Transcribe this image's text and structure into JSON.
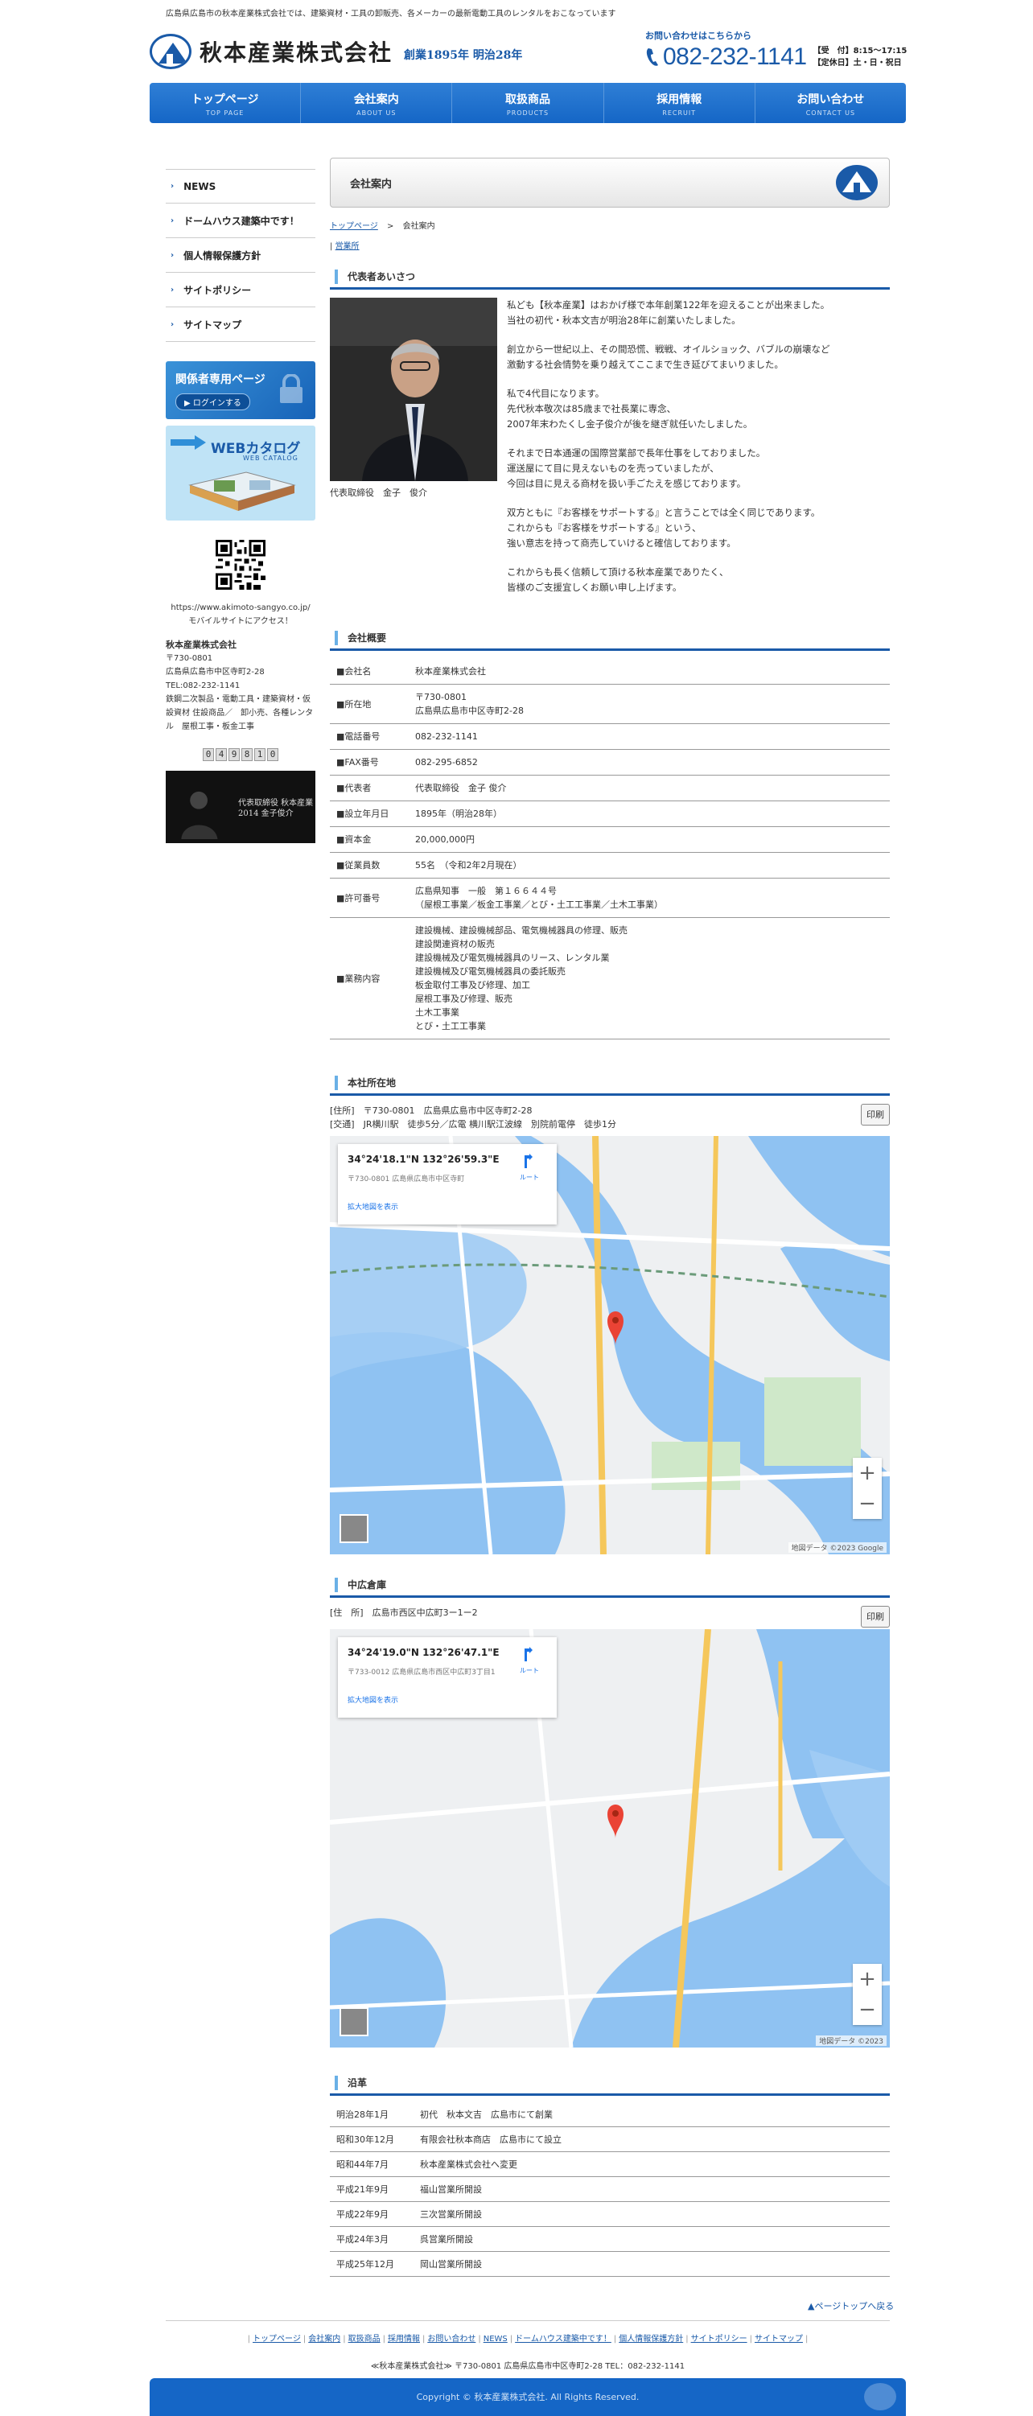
{
  "header": {
    "tagline": "広島県広島市の秋本産業株式会社では、建築資材・工具の卸販売、各メーカーの最新電動工具のレンタルをおこなっています",
    "company_name": "秋本産業株式会社",
    "founded": "創業1895年 明治28年",
    "contact_label": "お問い合わせはこちらから",
    "phone": "082-232-1141",
    "hours_line1": "【受　付】8:15～17:15",
    "hours_line2": "【定休日】土・日・祝日"
  },
  "gnav": [
    {
      "label": "トップページ",
      "sub": "TOP PAGE"
    },
    {
      "label": "会社案内",
      "sub": "ABOUT US"
    },
    {
      "label": "取扱商品",
      "sub": "PRODUCTS"
    },
    {
      "label": "採用情報",
      "sub": "RECRUIT"
    },
    {
      "label": "お問い合わせ",
      "sub": "CONTACT US"
    }
  ],
  "sidebar": {
    "menu": [
      "NEWS",
      "ドームハウス建築中です！",
      "個人情報保護方針",
      "サイトポリシー",
      "サイトマップ"
    ],
    "login_title": "関係者専用ページ",
    "login_button": "▶ ログインする",
    "catalog_title": "WEBカタログ",
    "catalog_sub": "WEB CATALOG",
    "qr_url": "https://www.akimoto-sangyo.co.jp/",
    "qr_note": "モバイルサイトにアクセス！",
    "company": "秋本産業株式会社",
    "zip": "〒730-0801",
    "address": "広島県広島市中区寺町2-28",
    "tel": "TEL:082-232-1141",
    "business": "鉄鋼二次製品・電動工具・建築資材・仮設資材 住設商品／　卸小売、各種レンタル　屋根工事・板金工事",
    "counter": [
      "0",
      "4",
      "9",
      "8",
      "1",
      "0"
    ],
    "president_banner": "代表取締役 秋本産業\n2014 金子俊介"
  },
  "page": {
    "title": "会社案内",
    "crumb_home": "トップページ",
    "crumb_sep": ">",
    "crumb_current": "会社案内",
    "sublink_sep": "|",
    "sublink": "営業所"
  },
  "greeting": {
    "heading": "代表者あいさつ",
    "caption": "代表取締役　金子　俊介",
    "paragraphs": [
      "私ども【秋本産業】はおかげ様で本年創業122年を迎えることが出来ました。\n当社の初代・秋本文吉が明治28年に創業いたしました。",
      "創立から一世紀以上、その間恐慌、戦戦、オイルショック、バブルの崩壊など\n激動する社会情勢を乗り越えてここまで生き延びてまいりました。",
      "私で4代目になります。\n先代秋本敬次は85歳まで社長業に専念、\n2007年末わたくし金子俊介が後を継ぎ就任いたしました。",
      "それまで日本通運の国際営業部で長年仕事をしておりました。\n運送屋にて目に見えないものを売っていましたが、\n今回は目に見える商材を扱い手ごたえを感じております。",
      "双方ともに『お客様をサポートする』と言うことでは全く同じであります。\nこれからも『お客様をサポートする』という、\n強い意志を持って商売していけると確信しております。",
      "これからも長く信頼して頂ける秋本産業でありたく、\n皆様のご支援宜しくお願い申し上げます。"
    ]
  },
  "overview": {
    "heading": "会社概要",
    "rows": [
      {
        "k": "■会社名",
        "v": "秋本産業株式会社"
      },
      {
        "k": "■所在地",
        "v": "〒730-0801\n広島県広島市中区寺町2-28"
      },
      {
        "k": "■電話番号",
        "v": "082-232-1141"
      },
      {
        "k": "■FAX番号",
        "v": "082-295-6852"
      },
      {
        "k": "■代表者",
        "v": "代表取締役　金子 俊介"
      },
      {
        "k": "■設立年月日",
        "v": "1895年（明治28年）"
      },
      {
        "k": "■資本金",
        "v": "20,000,000円"
      },
      {
        "k": "■従業員数",
        "v": "55名　（令和2年2月現在）"
      },
      {
        "k": "■許可番号",
        "v": "広島県知事　一般　第１６６４４号\n（屋根工事業／板金工事業／とび・土工工事業／土木工事業）"
      },
      {
        "k": "■業務内容",
        "v": "建設機械、建設機械部品、電気機械器具の修理、販売\n建設関連資材の販売\n建設機械及び電気機械器具のリース、レンタル業\n建設機械及び電気機械器具の委託販売\n板金取付工事及び修理、加工\n屋根工事及び修理、販売\n土木工事業\nとび・土工工事業"
      }
    ]
  },
  "hq_map": {
    "heading": "本社所在地",
    "address": "[住所]　〒730-0801　広島県広島市中区寺町2-28",
    "access": "[交通]　JR横川駅　徒歩5分／広電 横川駅江波線　別院前電停　徒歩1分",
    "print": "印刷",
    "coord": "34°24'18.1\"N 132°26'59.3\"E",
    "sub": "〒730-0801 広島県広島市中区寺町",
    "link": "拡大地図を表示",
    "route": "ルート",
    "attrib": "地図データ ©2023 Google"
  },
  "warehouse_map": {
    "heading": "中広倉庫",
    "address": "[住　所]　広島市西区中広町3ー1ー2",
    "print": "印刷",
    "coord": "34°24'19.0\"N 132°26'47.1\"E",
    "sub": "〒733-0012 広島県広島市西区中広町3丁目1",
    "link": "拡大地図を表示",
    "route": "ルート",
    "attrib": "地図データ ©2023"
  },
  "history": {
    "heading": "沿革",
    "rows": [
      {
        "k": "明治28年1月",
        "v": "初代　秋本文吉　広島市にて創業"
      },
      {
        "k": "昭和30年12月",
        "v": "有限会社秋本商店　広島市にて設立"
      },
      {
        "k": "昭和44年7月",
        "v": "秋本産業株式会社へ変更"
      },
      {
        "k": "平成21年9月",
        "v": "福山営業所開設"
      },
      {
        "k": "平成22年9月",
        "v": "三次営業所開設"
      },
      {
        "k": "平成24年3月",
        "v": "呉営業所開設"
      },
      {
        "k": "平成25年12月",
        "v": "岡山営業所開設"
      }
    ]
  },
  "footer": {
    "pagetop": "▲ページトップへ戻る",
    "links": [
      "トップページ",
      "会社案内",
      "取扱商品",
      "採用情報",
      "お問い合わせ",
      "NEWS",
      "ドームハウス建築中です！",
      "個人情報保護方針",
      "サイトポリシー",
      "サイトマップ"
    ],
    "address": "≪秋本産業株式会社≫ 〒730-0801 広島県広島市中区寺町2-28 TEL：082-232-1141",
    "copyright": "Copyright © 秋本産業株式会社. All Rights Reserved."
  },
  "colors": {
    "brand": "#1a5aa8",
    "nav": "#1566c6"
  }
}
